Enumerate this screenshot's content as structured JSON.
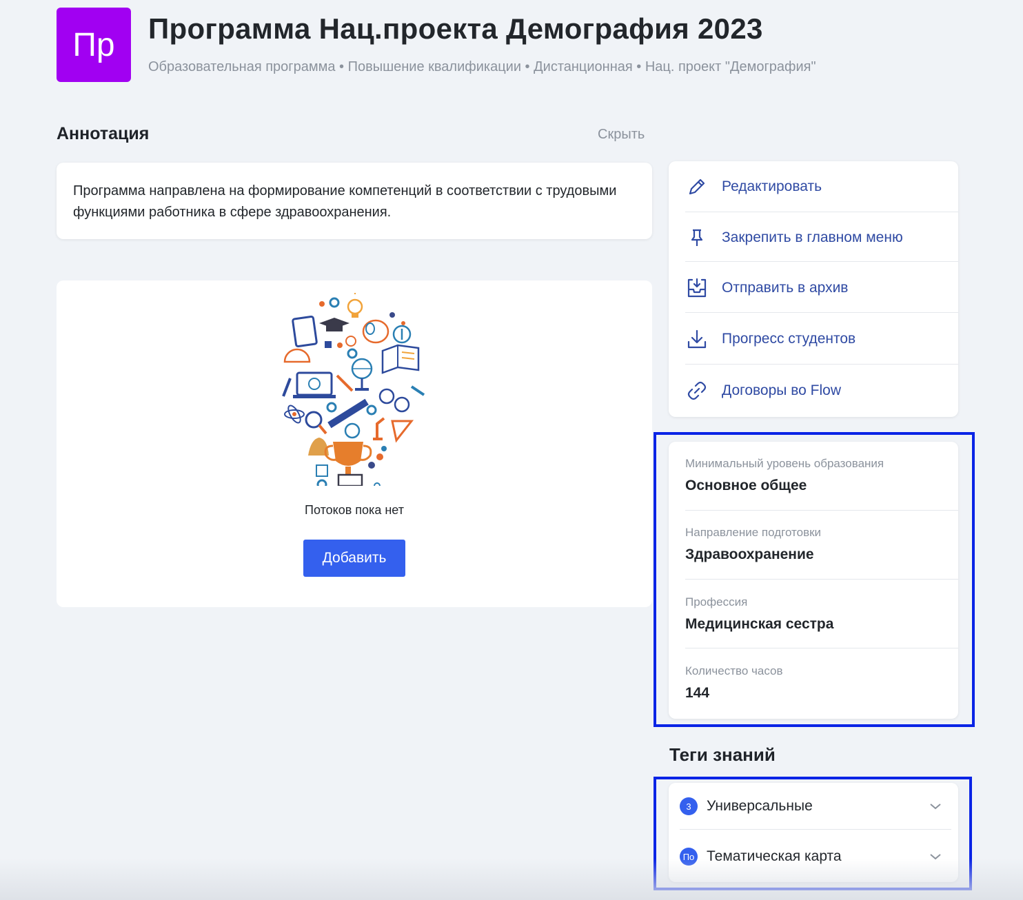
{
  "header": {
    "logo_text": "Пр",
    "logo_color": "#a100f2",
    "title": "Программа Нац.проекта Демография 2023",
    "subtitle": "Образовательная программа • Повышение квалификации • Дистанционная • Нац. проект \"Демография\""
  },
  "annotation": {
    "heading": "Аннотация",
    "hide_label": "Скрыть",
    "text": "Программа направлена на формирование компетенций в соответствии с трудовыми функциями работника в сфере здравоохранения."
  },
  "streams": {
    "illustration": "education-icons-illustration",
    "empty_text": "Потоков пока нет",
    "add_label": "Добавить"
  },
  "actions": [
    {
      "icon": "pencil-icon",
      "label": "Редактировать"
    },
    {
      "icon": "pin-icon",
      "label": "Закрепить в главном меню"
    },
    {
      "icon": "archive-icon",
      "label": "Отправить в архив"
    },
    {
      "icon": "download-icon",
      "label": "Прогресс студентов"
    },
    {
      "icon": "link-icon",
      "label": "Договоры во Flow"
    }
  ],
  "info": [
    {
      "label": "Минимальный уровень образования",
      "value": "Основное общее"
    },
    {
      "label": "Направление подготовки",
      "value": "Здравоохранение"
    },
    {
      "label": "Профессия",
      "value": "Медицинская сестра"
    },
    {
      "label": "Количество часов",
      "value": "144"
    }
  ],
  "tags": {
    "heading": "Теги знаний",
    "items": [
      {
        "badge": "3",
        "label": "Универсальные"
      },
      {
        "badge": "По",
        "label": "Тематическая карта"
      }
    ]
  },
  "colors": {
    "accent": "#3460ee",
    "action_text": "#2f4aa3",
    "highlight_frame": "#0a24e6",
    "background": "#f0f3f7"
  }
}
